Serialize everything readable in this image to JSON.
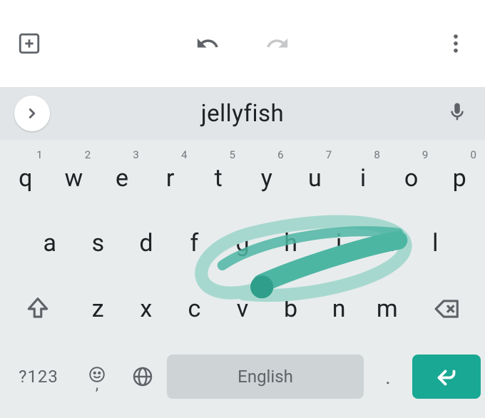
{
  "toolbar": {
    "new_tab": "+",
    "undo": "undo",
    "redo": "redo",
    "more": "more"
  },
  "suggestion": {
    "word": "jellyfish"
  },
  "keyboard": {
    "row1": [
      {
        "letter": "q",
        "num": "1"
      },
      {
        "letter": "w",
        "num": "2"
      },
      {
        "letter": "e",
        "num": "3"
      },
      {
        "letter": "r",
        "num": "4"
      },
      {
        "letter": "t",
        "num": "5"
      },
      {
        "letter": "y",
        "num": "6"
      },
      {
        "letter": "u",
        "num": "7"
      },
      {
        "letter": "i",
        "num": "8"
      },
      {
        "letter": "o",
        "num": "9"
      },
      {
        "letter": "p",
        "num": "0"
      }
    ],
    "row2": [
      {
        "letter": "a"
      },
      {
        "letter": "s"
      },
      {
        "letter": "d"
      },
      {
        "letter": "f"
      },
      {
        "letter": "g"
      },
      {
        "letter": "h"
      },
      {
        "letter": "j"
      },
      {
        "letter": "k"
      },
      {
        "letter": "l"
      }
    ],
    "row3": [
      {
        "letter": "z"
      },
      {
        "letter": "x"
      },
      {
        "letter": "c"
      },
      {
        "letter": "v"
      },
      {
        "letter": "b"
      },
      {
        "letter": "n"
      },
      {
        "letter": "m"
      }
    ],
    "symbols_label": "?123",
    "comma": ",",
    "space_label": "English",
    "period": "."
  },
  "colors": {
    "accent": "#19a893",
    "swipe": "#4db6a3",
    "swipe_light": "#a7d8cf"
  }
}
